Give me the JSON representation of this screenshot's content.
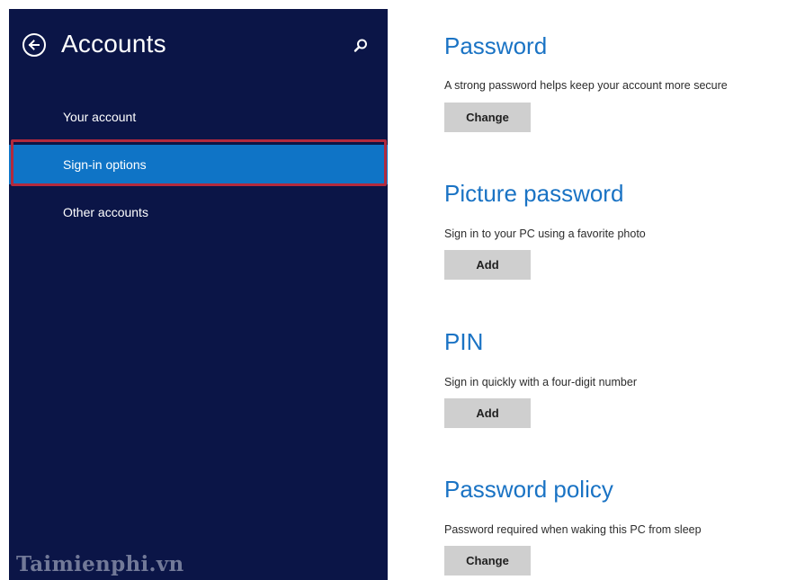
{
  "sidebar": {
    "title": "Accounts",
    "back_icon": "back-arrow-circle-icon",
    "search_icon": "search-icon",
    "items": [
      {
        "label": "Your account",
        "selected": false
      },
      {
        "label": "Sign-in options",
        "selected": true
      },
      {
        "label": "Other accounts",
        "selected": false
      }
    ]
  },
  "main": {
    "sections": [
      {
        "heading": "Password",
        "description": "A strong password helps keep your account more secure",
        "button_label": "Change"
      },
      {
        "heading": "Picture password",
        "description": "Sign in to your PC using a favorite photo",
        "button_label": "Add"
      },
      {
        "heading": "PIN",
        "description": "Sign in quickly with a four-digit number",
        "button_label": "Add"
      },
      {
        "heading": "Password policy",
        "description": "Password required when waking this PC from sleep",
        "button_label": "Change"
      }
    ]
  },
  "watermark": "Taimienphi.vn",
  "colors": {
    "sidebar_bg": "#0b1547",
    "selected_bg": "#0f74c6",
    "highlight_border": "#b32a3d",
    "heading_blue": "#1a73c4",
    "button_bg": "#cfcfcf"
  }
}
